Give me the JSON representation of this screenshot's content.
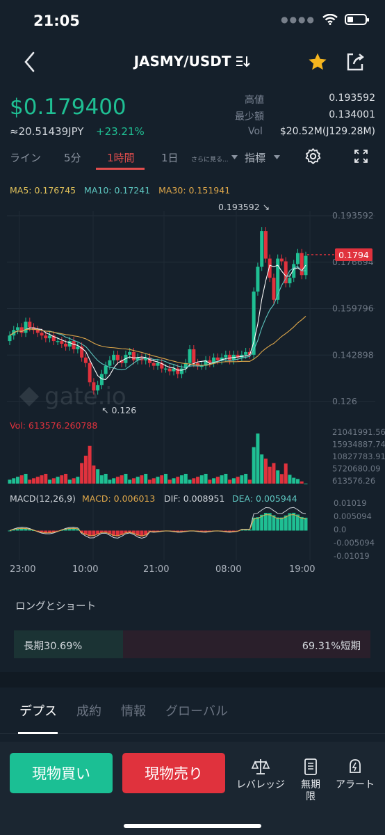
{
  "status": {
    "time": "21:05",
    "dots": "●●●●"
  },
  "header": {
    "pair": "JASMY/USDT",
    "pair_icon": "swap-list-icon",
    "star_color": "#f5b51e"
  },
  "ticker": {
    "price": "$0.179400",
    "fiat": "≈20.51439JPY",
    "change": "+23.21%",
    "high_label": "高値",
    "high": "0.193592",
    "low_label": "最少額",
    "low": "0.134001",
    "vol_label": "Vol",
    "vol": "$20.52M(J129.28M)"
  },
  "tabs": {
    "line": "ライン",
    "m5": "5分",
    "h1": "1時間",
    "d1": "1日",
    "more": "さらに見る...",
    "indicator": "指標"
  },
  "ma": {
    "ma5": "MA5: 0.176745",
    "ma10": "MA10: 0.17241",
    "ma30": "MA30: 0.151941"
  },
  "price_axis": [
    "0.193592",
    "0.176694",
    "0.159796",
    "0.142898",
    "0.126"
  ],
  "current_price_tag": "0.1794",
  "high_marker": "0.193592",
  "low_marker": "0.126",
  "volume": {
    "label": "Vol: 613576.260788",
    "axis": [
      "21041991.56",
      "15934887.74",
      "10827783.91",
      "5720680.09",
      "613576.26"
    ]
  },
  "macd": {
    "name": "MACD(12,26,9)",
    "macd": "MACD: 0.006013",
    "dif": "DIF: 0.008951",
    "dea": "DEA: 0.005944",
    "axis": [
      "0.01019",
      "0.005094",
      "0.0",
      "-0.005094",
      "-0.01019"
    ]
  },
  "time_axis": [
    "23:00",
    "10:00",
    "21:00",
    "08:00",
    "19:00"
  ],
  "colors": {
    "up": "#1fbf93",
    "down": "#e0323d",
    "ma5": "#ffffff",
    "ma10": "#5ec7c1",
    "ma30": "#e0a84a"
  },
  "long_short": {
    "title": "ロングとショート",
    "long": "長期30.69%",
    "short": "69.31%短期",
    "long_fraction": 0.3069
  },
  "bottom_tabs": {
    "depth": "デプス",
    "trades": "成約",
    "info": "情報",
    "global": "グローバル"
  },
  "actions": {
    "buy": "現物買い",
    "sell": "現物売り",
    "leverage": "レバレッジ",
    "perpetual": "無期限",
    "alert": "アラート"
  },
  "chart_data": {
    "type": "candlestick",
    "interval": "1時間",
    "price_axis_ticks": [
      0.126,
      0.142898,
      0.159796,
      0.176694,
      0.193592
    ],
    "time_ticks": [
      "23:00",
      "10:00",
      "21:00",
      "08:00",
      "19:00"
    ],
    "last_price": 0.1794,
    "high": 0.193592,
    "low": 0.126,
    "ma": {
      "MA5": 0.176745,
      "MA10": 0.17241,
      "MA30": 0.151941
    },
    "last_volume": 613576.260788,
    "volume_ticks": [
      613576.26,
      5720680.09,
      10827783.91,
      15934887.74,
      21041991.56
    ],
    "macd_params": [
      12,
      26,
      9
    ],
    "macd_values": {
      "MACD": 0.006013,
      "DIF": 0.008951,
      "DEA": 0.005944
    },
    "macd_ticks": [
      -0.01019,
      -0.005094,
      0.0,
      0.005094,
      0.01019
    ]
  }
}
